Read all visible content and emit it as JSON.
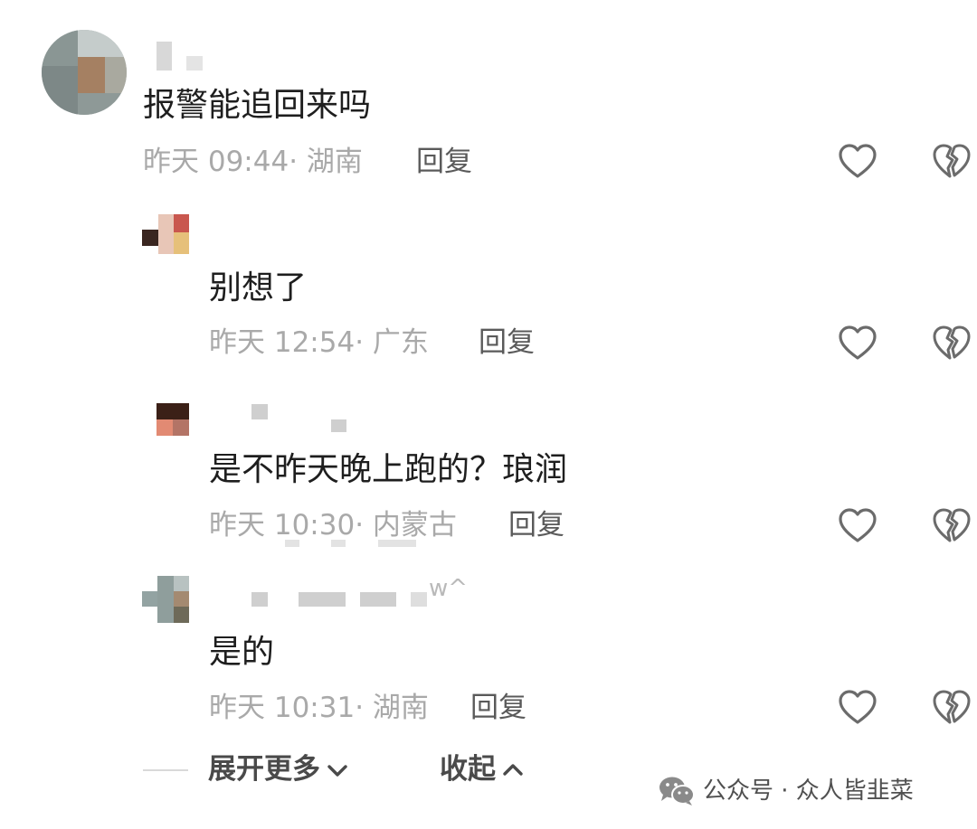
{
  "comments": [
    {
      "text": "报警能追回来吗",
      "time": "昨天 09:44",
      "location": "湖南",
      "reply_label": "回复"
    },
    {
      "text": "别想了",
      "time": "昨天 12:54",
      "location": "广东",
      "reply_label": "回复"
    },
    {
      "text": "是不昨天晚上跑的？琅润",
      "time": "昨天 10:30",
      "location": "内蒙古",
      "reply_label": "回复"
    },
    {
      "text": "是的",
      "time": "昨天 10:31",
      "location": "湖南",
      "reply_label": "回复"
    }
  ],
  "username_fragment": "w^",
  "footer": {
    "expand_label": "展开更多",
    "collapse_label": "收起"
  },
  "watermark": {
    "text": "公众号 · 众人皆韭菜"
  },
  "icons": {
    "like": "heart-outline-icon",
    "dislike": "broken-heart-icon",
    "expand": "chevron-down-icon",
    "collapse": "chevron-up-icon",
    "wechat": "wechat-logo-icon"
  },
  "colors": {
    "text_primary": "#1e1e1e",
    "text_meta": "#a9a9a9",
    "text_reply": "#5a5a5a",
    "icon_stroke": "#6b6b6b"
  }
}
